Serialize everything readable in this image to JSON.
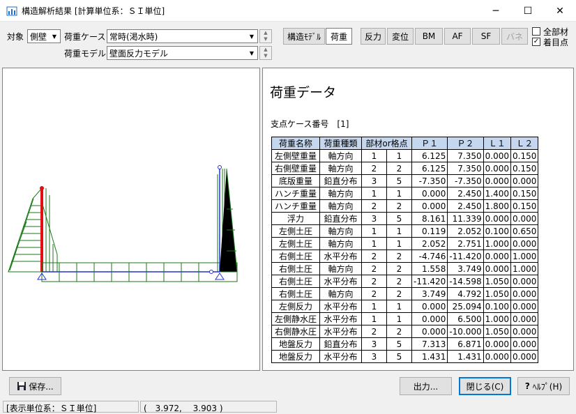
{
  "window": {
    "title": "構造解析結果 [計算単位系：ＳＩ単位]",
    "minimize": "─",
    "maximize": "☐",
    "close": "✕"
  },
  "toolbar": {
    "target_label": "対象",
    "target_value": "側壁",
    "load_case_label": "荷重ケース",
    "load_case_value": "常時(渇水時)",
    "load_model_label": "荷重モデル",
    "load_model_value": "壁面反力モデル",
    "buttons": {
      "structure_model": "構造ﾓﾃﾞﾙ",
      "load": "荷重",
      "reaction": "反力",
      "displacement": "変位",
      "bm": "BM",
      "af": "AF",
      "sf": "SF",
      "spring": "バネ"
    },
    "all_members": "全部材",
    "focus_point": "着目点"
  },
  "right": {
    "heading": "荷重データ",
    "support_case": "支点ケース番号　[1]",
    "columns": [
      "荷重名称",
      "荷重種類",
      "部材or格点",
      "Ｐ１",
      "Ｐ２",
      "Ｌ１",
      "Ｌ２"
    ],
    "rows": [
      [
        "左側壁重量",
        "軸方向",
        "1",
        "1",
        "6.125",
        "7.350",
        "0.000",
        "0.150"
      ],
      [
        "右側壁重量",
        "軸方向",
        "2",
        "2",
        "6.125",
        "7.350",
        "0.000",
        "0.150"
      ],
      [
        "底版重量",
        "鉛直分布",
        "3",
        "5",
        "-7.350",
        "-7.350",
        "0.000",
        "0.000"
      ],
      [
        "ハンチ重量",
        "軸方向",
        "1",
        "1",
        "0.000",
        "2.450",
        "1.400",
        "0.150"
      ],
      [
        "ハンチ重量",
        "軸方向",
        "2",
        "2",
        "0.000",
        "2.450",
        "1.800",
        "0.150"
      ],
      [
        "浮力",
        "鉛直分布",
        "3",
        "5",
        "8.161",
        "11.339",
        "0.000",
        "0.000"
      ],
      [
        "左側土圧",
        "軸方向",
        "1",
        "1",
        "0.119",
        "2.052",
        "0.100",
        "0.650"
      ],
      [
        "左側土圧",
        "軸方向",
        "1",
        "1",
        "2.052",
        "2.751",
        "1.000",
        "0.000"
      ],
      [
        "右側土圧",
        "水平分布",
        "2",
        "2",
        "-4.746",
        "-11.420",
        "0.000",
        "1.000"
      ],
      [
        "右側土圧",
        "軸方向",
        "2",
        "2",
        "1.558",
        "3.749",
        "0.000",
        "1.000"
      ],
      [
        "右側土圧",
        "水平分布",
        "2",
        "2",
        "-11.420",
        "-14.598",
        "1.050",
        "0.000"
      ],
      [
        "右側土圧",
        "軸方向",
        "2",
        "2",
        "3.749",
        "4.792",
        "1.050",
        "0.000"
      ],
      [
        "左側反力",
        "水平分布",
        "1",
        "1",
        "0.000",
        "25.094",
        "0.100",
        "0.000"
      ],
      [
        "左側静水圧",
        "水平分布",
        "1",
        "1",
        "0.000",
        "6.500",
        "1.000",
        "0.000"
      ],
      [
        "右側静水圧",
        "水平分布",
        "2",
        "2",
        "0.000",
        "-10.000",
        "1.050",
        "0.000"
      ],
      [
        "地盤反力",
        "鉛直分布",
        "3",
        "5",
        "7.313",
        "6.871",
        "0.000",
        "0.000"
      ],
      [
        "地盤反力",
        "水平分布",
        "3",
        "5",
        "1.431",
        "1.431",
        "0.000",
        "0.000"
      ]
    ]
  },
  "bottom": {
    "save": "保存...",
    "output": "出力...",
    "close": "閉じる(C)",
    "help": "ﾍﾙﾌﾟ(H)"
  },
  "status": {
    "units": "[表示単位系：ＳＩ単位]",
    "coords": "(　3.972,　 3.903 )"
  }
}
